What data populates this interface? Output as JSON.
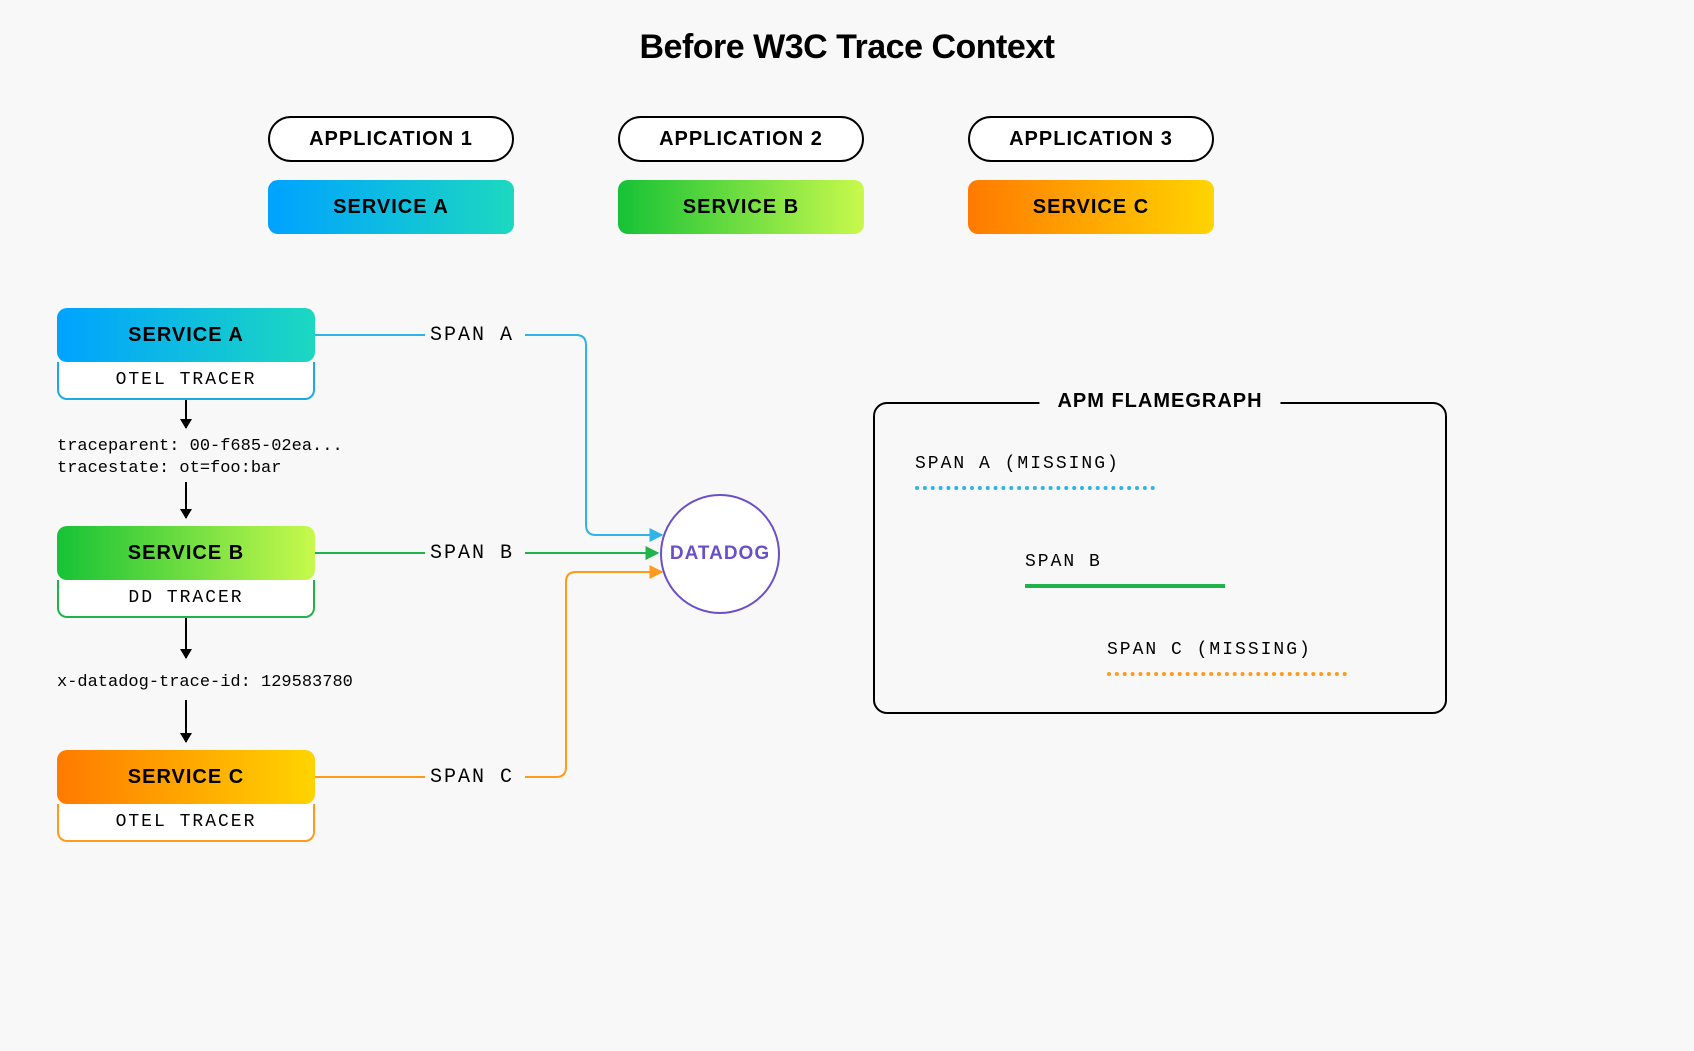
{
  "title": "Before W3C Trace Context",
  "applications": [
    {
      "label": "APPLICATION 1",
      "service": "SERVICE A"
    },
    {
      "label": "APPLICATION 2",
      "service": "SERVICE B"
    },
    {
      "label": "APPLICATION 3",
      "service": "SERVICE C"
    }
  ],
  "chain": {
    "a": {
      "service": "SERVICE A",
      "tracer": "OTEL TRACER",
      "span": "SPAN A",
      "color": "#1ea8e6"
    },
    "ctx_ab_line1": "traceparent: 00-f685-02ea...",
    "ctx_ab_line2": "tracestate: ot=foo:bar",
    "b": {
      "service": "SERVICE B",
      "tracer": "DD TRACER",
      "span": "SPAN B",
      "color": "#1fb34a"
    },
    "ctx_bc": "x-datadog-trace-id: 129583780",
    "c": {
      "service": "SERVICE C",
      "tracer": "OTEL TRACER",
      "span": "SPAN C",
      "color": "#ff9a1a"
    }
  },
  "destination": "DATADOG",
  "flamegraph": {
    "title": "APM FLAMEGRAPH",
    "spanA": "SPAN A (MISSING)",
    "spanB": "SPAN B",
    "spanC": "SPAN C (MISSING)"
  },
  "colors": {
    "spanA": "#2fb3e8",
    "spanB": "#1fb34a",
    "spanC": "#ff9a1a",
    "datadog": "#6b4fc9"
  }
}
